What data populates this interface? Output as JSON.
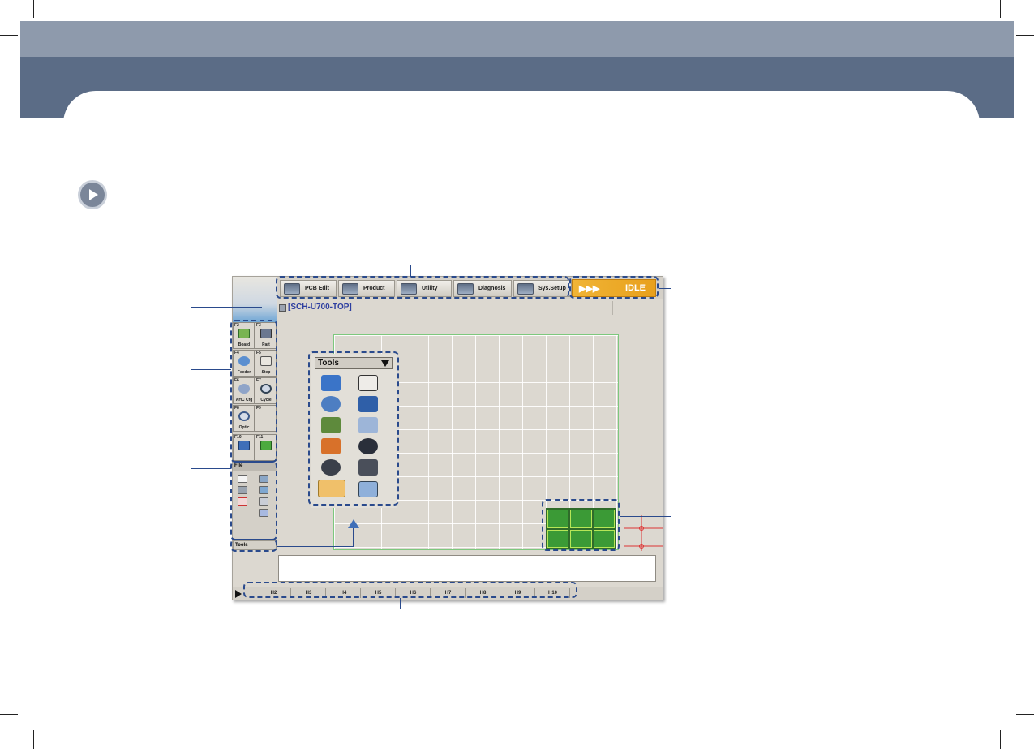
{
  "app": {
    "menu": [
      {
        "label": "PCB Edit",
        "icon": "pcb-edit-icon"
      },
      {
        "label": "Product",
        "icon": "product-icon"
      },
      {
        "label": "Utility",
        "icon": "utility-icon"
      },
      {
        "label": "Diagnosis",
        "icon": "diagnosis-icon"
      },
      {
        "label": "Sys.Setup",
        "icon": "sys-setup-icon"
      }
    ],
    "status": {
      "arrows": "▶▶▶",
      "label": "IDLE"
    },
    "title": "[SCH-U700-TOP]",
    "function_keys": [
      {
        "key": "F2",
        "label": "Board"
      },
      {
        "key": "F3",
        "label": "Part"
      },
      {
        "key": "F4",
        "label": "Feeder"
      },
      {
        "key": "F5",
        "label": "Step"
      },
      {
        "key": "F6",
        "label": "AHC Cfg"
      },
      {
        "key": "F7",
        "label": "Cycle"
      },
      {
        "key": "F8",
        "label": "Optic"
      },
      {
        "key": "F9",
        "label": ""
      },
      {
        "key": "F10",
        "label": ""
      },
      {
        "key": "F11",
        "label": ""
      }
    ],
    "file_panel": {
      "header": "File"
    },
    "tools_tab": "Tools",
    "tools_popup": {
      "selected": "Tools"
    },
    "hotkeys": [
      "H2",
      "H3",
      "H4",
      "H5",
      "H6",
      "H7",
      "H8",
      "H9",
      "H10"
    ]
  },
  "colors": {
    "header_top": "#8e9aac",
    "header_bottom": "#5b6c86",
    "callout": "#2a4a8c",
    "idle": "#e8a01c"
  }
}
